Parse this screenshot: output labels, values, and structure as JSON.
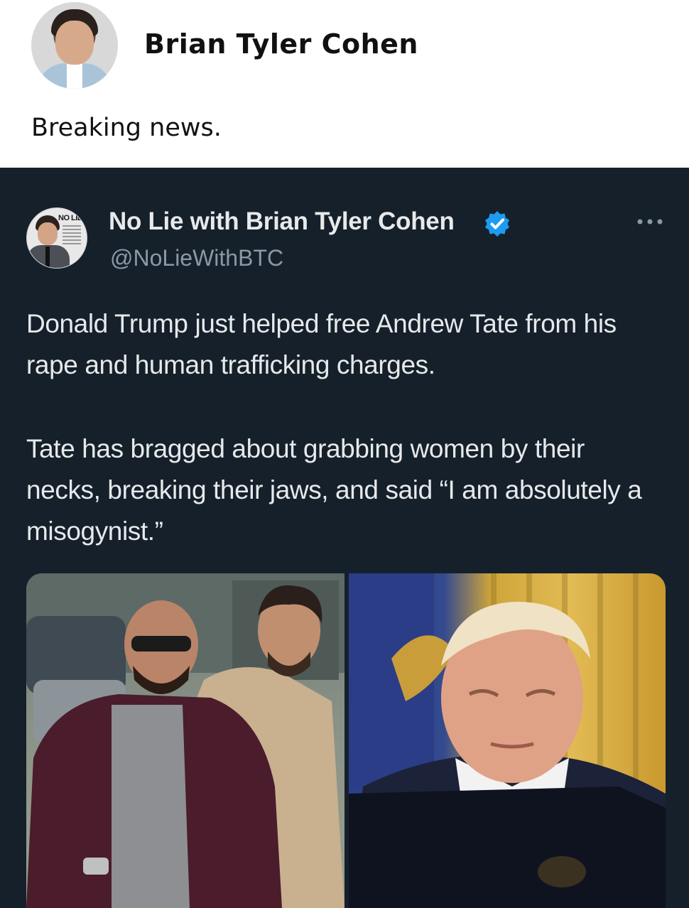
{
  "outer_post": {
    "author_name": "Brian Tyler Cohen",
    "text": "Breaking news."
  },
  "quoted_post": {
    "author_name": "No Lie with Brian Tyler Cohen",
    "handle": "@NoLieWithBTC",
    "avatar_logo_text": "NO LIE",
    "verified": true,
    "paragraphs": [
      "Donald Trump just helped free Andrew Tate from his rape and human trafficking charges.",
      "Tate has bragged about grabbing women by their necks, breaking their jaws, and said “I am absolutely a misogynist.”"
    ]
  },
  "colors": {
    "card_background": "#15202b",
    "primary_text": "#e7e9ea",
    "secondary_text": "#8b98a5",
    "verified_blue": "#1d9bf0"
  }
}
